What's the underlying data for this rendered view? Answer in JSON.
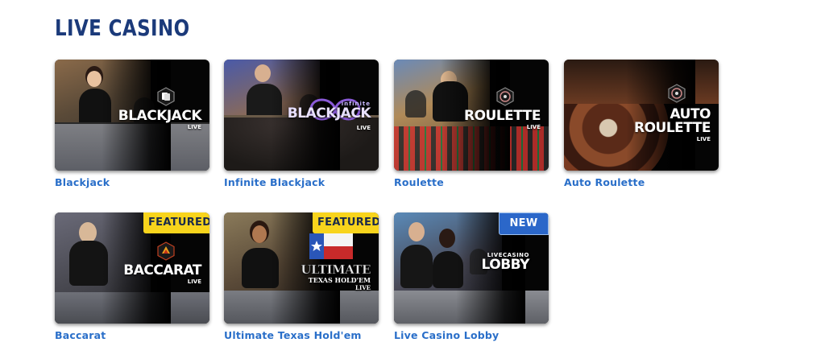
{
  "section": {
    "title": "LIVE CASINO"
  },
  "games": [
    {
      "label": "Blackjack",
      "logo_main": "BLACKJACK",
      "logo_sub": "LIVE",
      "badge": "",
      "emblem": "cards-icon"
    },
    {
      "label": "Infinite Blackjack",
      "logo_main": "BLACKJACK",
      "logo_pre": "infinite",
      "logo_sub": "LIVE",
      "badge": "",
      "emblem": "infinity-icon"
    },
    {
      "label": "Roulette",
      "logo_main": "ROULETTE",
      "logo_sub": "LIVE",
      "badge": "",
      "emblem": "roulette-wheel-icon"
    },
    {
      "label": "Auto Roulette",
      "logo_main": "AUTO",
      "logo_main2": "ROULETTE",
      "logo_sub": "LIVE",
      "badge": "",
      "emblem": "roulette-wheel-icon"
    },
    {
      "label": "Baccarat",
      "logo_main": "BACCARAT",
      "logo_sub": "LIVE",
      "badge": "FEATURED",
      "emblem": "baccarat-icon"
    },
    {
      "label": "Ultimate Texas Hold'em",
      "logo_main": "ULTIMATE",
      "logo_main2": "TEXAS HOLD'EM",
      "logo_sub": "LIVE",
      "badge": "FEATURED",
      "emblem": "texas-flag-icon"
    },
    {
      "label": "Live Casino Lobby",
      "logo_pre": "LIVECASINO",
      "logo_main": "LOBBY",
      "logo_sub": "",
      "badge": "NEW",
      "emblem": ""
    }
  ],
  "colors": {
    "title": "#1b3a7a",
    "link": "#2a6fc9",
    "featured_badge": "#f8d41c",
    "new_badge": "#2b67c9"
  }
}
